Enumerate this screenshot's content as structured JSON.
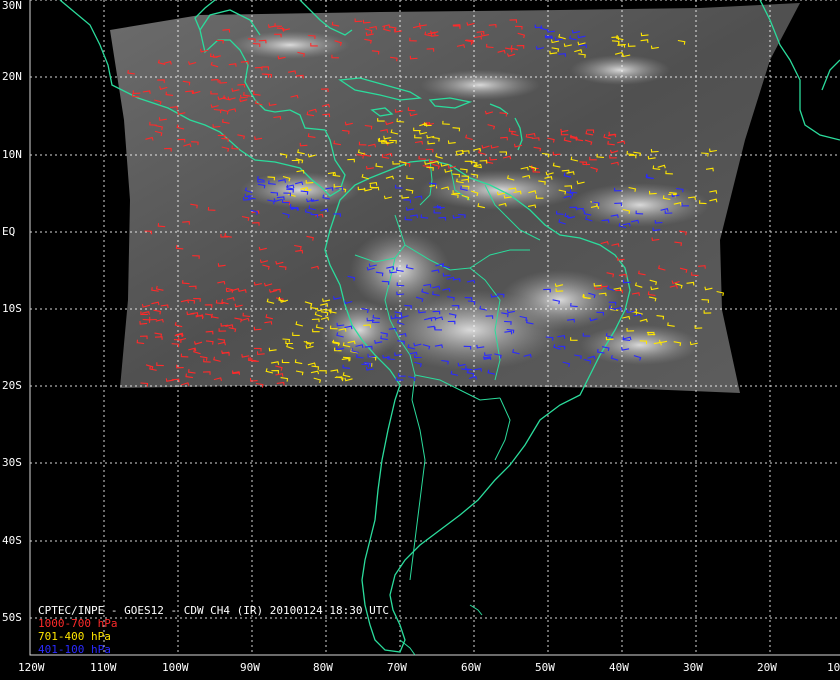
{
  "title": "CPTEC/INPE - GOES12 - CDW CH4 (IR) 20100124 18:30 UTC",
  "legend": [
    {
      "label": "1000-700 hPa",
      "color": "#ff2a2a"
    },
    {
      "label": "701-400 hPa",
      "color": "#ffe600"
    },
    {
      "label": "401-100 hPa",
      "color": "#2a2aff"
    }
  ],
  "lat_labels": [
    "30N",
    "20N",
    "10N",
    "EQ",
    "10S",
    "20S",
    "30S",
    "40S",
    "50S"
  ],
  "lon_labels": [
    "120W",
    "110W",
    "100W",
    "90W",
    "80W",
    "70W",
    "60W",
    "50W",
    "40W",
    "30W",
    "20W",
    "10"
  ],
  "colors": {
    "background": "#000000",
    "coastline": "#2bdc9c",
    "grid": "#ffffff",
    "image_frame": "#585858"
  }
}
